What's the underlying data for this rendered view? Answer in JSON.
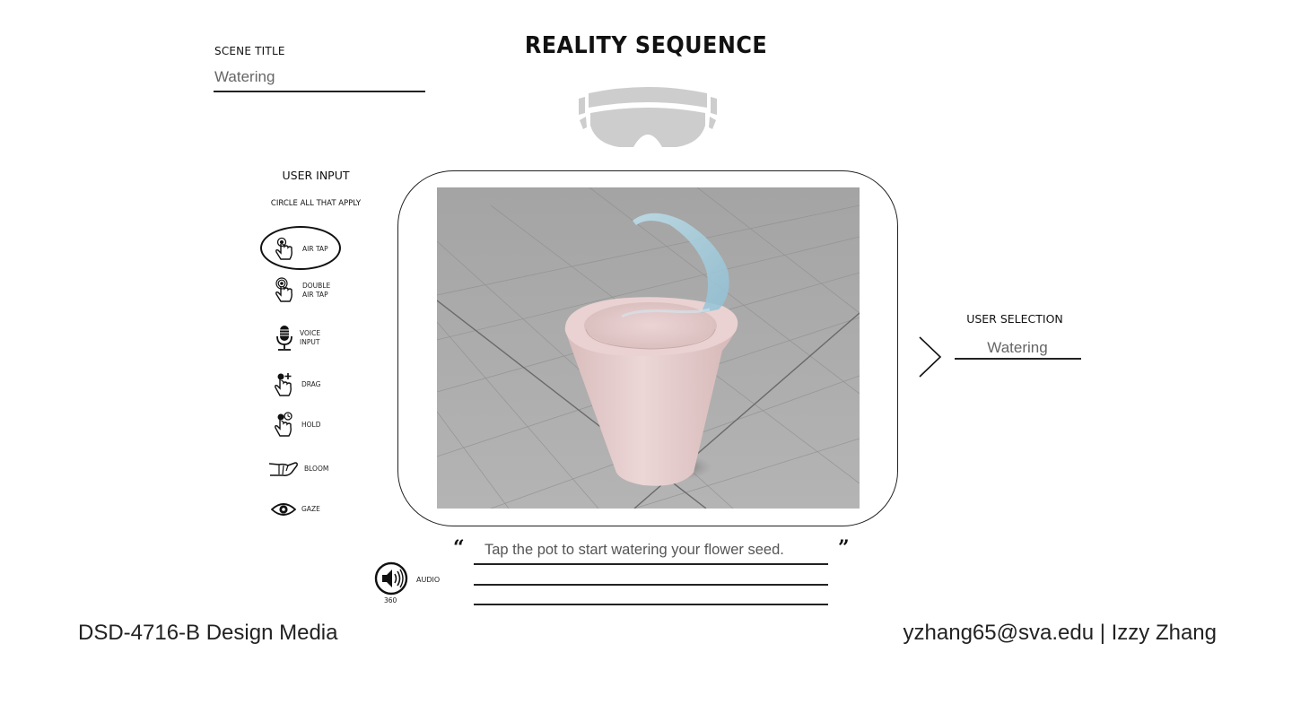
{
  "header": {
    "title": "REALITY SEQUENCE",
    "headset_icon": "mixed-reality-headset-icon"
  },
  "scene": {
    "label": "SCENE TITLE",
    "value": "Watering"
  },
  "user_input": {
    "title": "USER INPUT",
    "instruction": "CIRCLE ALL THAT APPLY",
    "items": [
      {
        "label_lines": [
          "AIR TAP"
        ],
        "icon": "air-tap-icon",
        "circled": true
      },
      {
        "label_lines": [
          "DOUBLE",
          "AIR TAP"
        ],
        "icon": "double-air-tap-icon",
        "circled": false
      },
      {
        "label_lines": [
          "VOICE",
          "INPUT"
        ],
        "icon": "microphone-icon",
        "circled": false
      },
      {
        "label_lines": [
          "DRAG"
        ],
        "icon": "drag-gesture-icon",
        "circled": false
      },
      {
        "label_lines": [
          "HOLD"
        ],
        "icon": "hold-gesture-icon",
        "circled": false
      },
      {
        "label_lines": [
          "BLOOM"
        ],
        "icon": "bloom-gesture-icon",
        "circled": false
      },
      {
        "label_lines": [
          "GAZE"
        ],
        "icon": "eye-icon",
        "circled": false
      }
    ]
  },
  "scene_view": {
    "description": "3D render of a pink flower pot on a gray tiled floor with a stream of water pouring in",
    "colors": {
      "floor": "#a9a9a9",
      "pot": "#e8cfcf",
      "water": "#a9d4e4"
    }
  },
  "user_selection": {
    "label": "USER SELECTION",
    "value": "Watering"
  },
  "audio": {
    "label": "AUDIO",
    "sublabel": "360",
    "icon": "speaker-icon"
  },
  "dialogue": {
    "open_quote": "“",
    "close_quote": "”",
    "lines": [
      "Tap the pot to start watering your flower seed.",
      "",
      ""
    ]
  },
  "footer": {
    "course": "DSD-4716-B Design Media",
    "author": "yzhang65@sva.edu | Izzy Zhang"
  }
}
